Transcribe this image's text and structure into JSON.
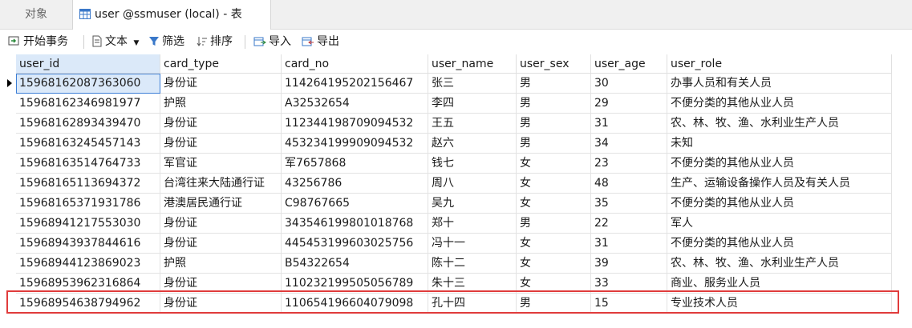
{
  "tabs": {
    "objects": "对象",
    "table": "user @ssmuser (local) - 表"
  },
  "toolbar": {
    "begin_tx": "开始事务",
    "text": "文本",
    "filter": "筛选",
    "sort": "排序",
    "import": "导入",
    "export": "导出"
  },
  "columns": [
    "user_id",
    "card_type",
    "card_no",
    "user_name",
    "user_sex",
    "user_age",
    "user_role"
  ],
  "rows": [
    [
      "15968162087363060",
      "身份证",
      "11426419520215646​7",
      "张三",
      "男",
      "30",
      "办事人员和有关人员"
    ],
    [
      "15968162346981977",
      "护照",
      "A32532654",
      "李四",
      "男",
      "29",
      "不便分类的其他从业人员"
    ],
    [
      "15968162893439470",
      "身份证",
      "112344198709094532",
      "王五",
      "男",
      "31",
      "农、林、牧、渔、水利业生产人员"
    ],
    [
      "15968163245457143",
      "身份证",
      "453234199909094532",
      "赵六",
      "男",
      "34",
      "未知"
    ],
    [
      "15968163514764733",
      "军官证",
      "军7657868",
      "钱七",
      "女",
      "23",
      "不便分类的其他从业人员"
    ],
    [
      "15968165113694372",
      "台湾往来大陆通行证",
      "43256786",
      "周八",
      "女",
      "48",
      "生产、运输设备操作人员及有关人员"
    ],
    [
      "15968165371931786",
      "港澳居民通行证",
      "C98767665",
      "吴九",
      "女",
      "35",
      "不便分类的其他从业人员"
    ],
    [
      "15968941217553030",
      "身份证",
      "343546199801018768",
      "郑十",
      "男",
      "22",
      "军人"
    ],
    [
      "15968943937844616",
      "身份证",
      "445453199603025756",
      "冯十一",
      "女",
      "31",
      "不便分类的其他从业人员"
    ],
    [
      "15968944123869023",
      "护照",
      "B54322654",
      "陈十二",
      "女",
      "39",
      "农、林、牧、渔、水利业生产人员"
    ],
    [
      "15968953962316864",
      "身份证",
      "110232199505056789",
      "朱十三",
      "女",
      "33",
      "商业、服务业人员"
    ],
    [
      "15968954638794962",
      "身份证",
      "110654196604079098",
      "孔十四",
      "男",
      "15",
      "专业技术人员"
    ]
  ],
  "colors": {
    "highlight_border": "#e03c3c",
    "selection": "#dbe9f9"
  }
}
